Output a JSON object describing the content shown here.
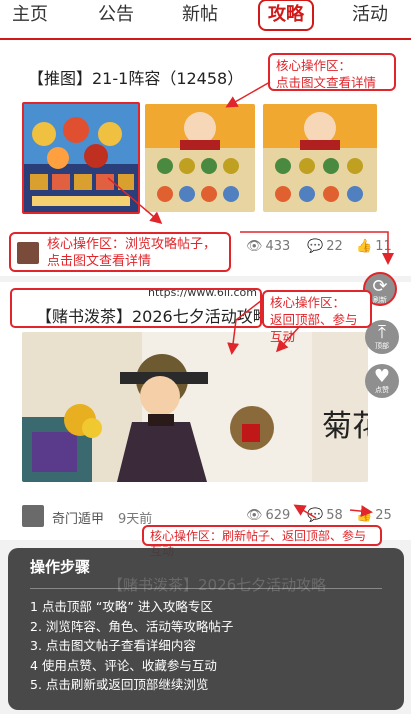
{
  "tabs": [
    {
      "label": "主页",
      "active": false
    },
    {
      "label": "公告",
      "active": false
    },
    {
      "label": "新帖",
      "active": false
    },
    {
      "label": "攻略",
      "active": true
    },
    {
      "label": "活动",
      "active": false
    }
  ],
  "post1": {
    "title": "【推图】21-1阵容（12458）",
    "views": "433",
    "comments": "22",
    "likes": "11"
  },
  "post2": {
    "title": "【赌书泼茶】2026七夕活动攻略",
    "author": "奇门遁甲",
    "time": "9天前",
    "views": "629",
    "comments": "58",
    "likes": "25"
  },
  "watermark": "https://www.6ll.com",
  "image_text": "菊花",
  "annotations": {
    "a1_line1": "核心操作区：",
    "a1_line2": "点击图文查看详情",
    "a2_line1": "核心操作区：浏览攻略帖子，",
    "a2_line2": "点击图文查看详情",
    "a3_line1": "核心操作区：",
    "a3_line2": "返回顶部、参与互动",
    "a4": "核心操作区：刷新帖子、返回顶部、参与互动"
  },
  "fabs": {
    "refresh": "刷新",
    "top": "顶部",
    "like": "点赞"
  },
  "steps": {
    "title": "操作步骤",
    "items": [
      "1  点击顶部 “攻略” 进入攻略专区",
      "2. 浏览阵容、角色、活动等攻略帖子",
      "3. 点击图文帖子查看详细内容",
      "4  使用点赞、评论、收藏参与互动",
      "5. 点击刷新或返回顶部继续浏览"
    ],
    "ghost_title": "【赌书泼茶】2026七夕活动攻略"
  },
  "colors": {
    "accent": "#d01a1a",
    "annotation": "#e0262b"
  }
}
